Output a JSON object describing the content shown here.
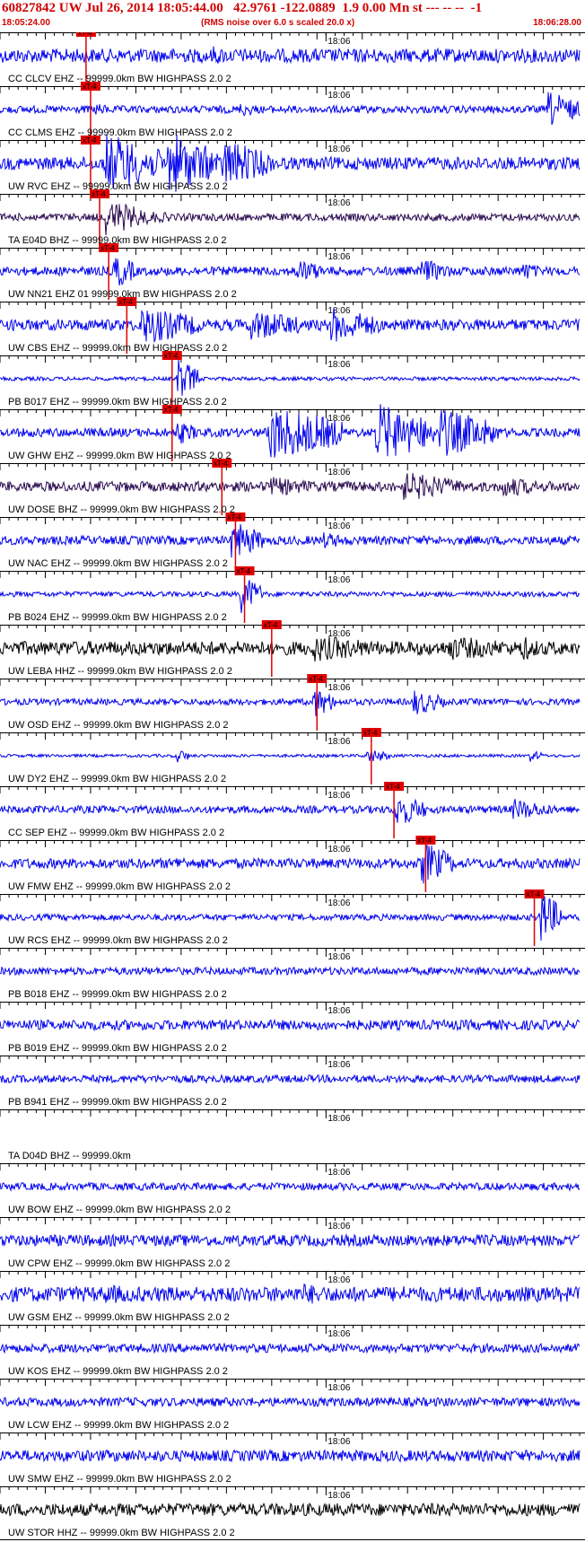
{
  "header": {
    "title": "60827842 UW Jul 26, 2014 18:05:44.00   42.9761 -122.0889  1.9 0.00 Mn st --- -- --  -1",
    "start_time": "18:05:24.00",
    "note": "(RMS noise over 6.0 s scaled 20.0 x)",
    "end_time": "18:06:28.00"
  },
  "chart_data": {
    "type": "line",
    "time_range": [
      "18:05:24.00",
      "18:06:28.00"
    ],
    "minute_mark": "18:06",
    "minute_mark_time_s": 36,
    "pick_label": "xT-4",
    "colors": {
      "blue": "#0000ee",
      "purple": "#2a0a50",
      "black": "#000000",
      "pick": "#e00000"
    },
    "traces": [
      {
        "label": "CC CLCV EHZ -- 99999.0km BW  HIGHPASS  2.0  2",
        "color": "blue",
        "pick_s": 9.5,
        "amp": 0.55,
        "bursts": [
          [
            10,
            3,
            0.6
          ],
          [
            24,
            2,
            0.8
          ],
          [
            31,
            2,
            0.4
          ]
        ]
      },
      {
        "label": "CC CLMS EHZ -- 99999.0km BW  HIGHPASS  2.0  2",
        "color": "blue",
        "pick_s": 10.0,
        "amp": 0.3,
        "bursts": [
          [
            11,
            2,
            0.5
          ],
          [
            27,
            2,
            0.6
          ],
          [
            61,
            3,
            1.5
          ]
        ]
      },
      {
        "label": "UW RVC EHZ -- 99999.0km BW  HIGHPASS  2.0  2",
        "color": "blue",
        "pick_s": 10.0,
        "amp": 0.5,
        "bursts": [
          [
            12,
            6,
            2.5
          ],
          [
            19,
            5,
            2.6
          ],
          [
            25,
            5,
            2.0
          ]
        ]
      },
      {
        "label": "TA E04D BHZ -- 99999.0km BW  HIGHPASS  2.0  2",
        "color": "purple",
        "pick_s": 11.0,
        "amp": 0.3,
        "bursts": [
          [
            12,
            4,
            1.5
          ],
          [
            16,
            4,
            0.6
          ]
        ]
      },
      {
        "label": "UW NN21 EHZ 01 99999.0km BW  HIGHPASS  2.0  2",
        "color": "blue",
        "pick_s": 12.0,
        "amp": 0.35,
        "bursts": [
          [
            13,
            2,
            1.5
          ],
          [
            33,
            3,
            1.0
          ],
          [
            47,
            3,
            1.0
          ],
          [
            58,
            2,
            0.8
          ]
        ]
      },
      {
        "label": "UW CBS EHZ -- 99999.0km BW  HIGHPASS  2.0  2",
        "color": "blue",
        "pick_s": 14.0,
        "amp": 0.45,
        "bursts": [
          [
            16,
            6,
            1.6
          ],
          [
            28,
            6,
            1.3
          ],
          [
            37,
            5,
            1.5
          ]
        ]
      },
      {
        "label": "PB B017 EHZ -- 99999.0km BW  HIGHPASS  2.0  2",
        "color": "blue",
        "pick_s": 19.0,
        "amp": 0.15,
        "bursts": [
          [
            20,
            2,
            1.7
          ]
        ]
      },
      {
        "label": "UW GHW EHZ -- 99999.0km BW  HIGHPASS  2.0  2",
        "color": "blue",
        "pick_s": 19.0,
        "amp": 0.35,
        "bursts": [
          [
            20,
            2,
            1.0
          ],
          [
            30,
            8,
            2.3
          ],
          [
            42,
            6,
            2.4
          ],
          [
            49,
            6,
            2.0
          ]
        ]
      },
      {
        "label": "UW DOSE BHZ -- 99999.0km BW  HIGHPASS  2.0  2",
        "color": "purple",
        "pick_s": 24.5,
        "amp": 0.4,
        "bursts": [
          [
            30,
            6,
            0.8
          ],
          [
            45,
            6,
            1.2
          ],
          [
            56,
            4,
            0.9
          ]
        ]
      },
      {
        "label": "UW NAC EHZ -- 99999.0km BW  HIGHPASS  2.0  2",
        "color": "blue",
        "pick_s": 26.0,
        "amp": 0.35,
        "bursts": [
          [
            26,
            3,
            1.6
          ],
          [
            36,
            3,
            0.7
          ]
        ]
      },
      {
        "label": "PB B024 EHZ -- 99999.0km BW  HIGHPASS  2.0  2",
        "color": "blue",
        "pick_s": 27.0,
        "amp": 0.2,
        "bursts": [
          [
            27,
            2,
            1.6
          ]
        ]
      },
      {
        "label": "UW LEBA HHZ -- 99999.0km BW  HIGHPASS  2.0  2",
        "color": "black",
        "pick_s": 30.0,
        "amp": 0.55,
        "bursts": [
          [
            35,
            8,
            1.1
          ],
          [
            50,
            8,
            1.0
          ],
          [
            58,
            2,
            1.1
          ]
        ]
      },
      {
        "label": "UW OSD EHZ -- 99999.0km BW  HIGHPASS  2.0  2",
        "color": "blue",
        "pick_s": 35.0,
        "amp": 0.25,
        "bursts": [
          [
            35,
            2,
            1.3
          ],
          [
            46,
            3,
            1.1
          ]
        ]
      },
      {
        "label": "UW DY2 EHZ -- 99999.0km BW  HIGHPASS  2.0  2",
        "color": "blue",
        "pick_s": 41.0,
        "amp": 0.12,
        "bursts": [
          [
            20,
            1,
            0.6
          ],
          [
            41,
            2,
            0.6
          ],
          [
            59,
            1,
            0.5
          ]
        ]
      },
      {
        "label": "CC SEP EHZ -- 99999.0km BW  HIGHPASS  2.0  2",
        "color": "blue",
        "pick_s": 43.5,
        "amp": 0.3,
        "bursts": [
          [
            44,
            3,
            1.4
          ],
          [
            57,
            4,
            0.9
          ]
        ]
      },
      {
        "label": "UW FMW EHZ -- 99999.0km BW  HIGHPASS  2.0  2",
        "color": "blue",
        "pick_s": 47.0,
        "amp": 0.4,
        "bursts": [
          [
            20,
            2,
            0.6
          ],
          [
            47,
            3,
            1.8
          ]
        ]
      },
      {
        "label": "UW RCS EHZ -- 99999.0km BW  HIGHPASS  2.0  2",
        "color": "blue",
        "pick_s": 59.0,
        "amp": 0.25,
        "bursts": [
          [
            60,
            2,
            2.2
          ]
        ]
      },
      {
        "label": "PB B018 EHZ -- 99999.0km BW  HIGHPASS  2.0  2",
        "color": "blue",
        "amp": 0.3,
        "bursts": []
      },
      {
        "label": "PB B019 EHZ -- 99999.0km BW  HIGHPASS  2.0  2",
        "color": "blue",
        "amp": 0.4,
        "bursts": []
      },
      {
        "label": "PB B941 EHZ -- 99999.0km BW  HIGHPASS  2.0  2",
        "color": "blue",
        "amp": 0.3,
        "bursts": []
      },
      {
        "label": "TA D04D BHZ -- 99999.0km",
        "color": "none",
        "amp": 0,
        "bursts": []
      },
      {
        "label": "UW BOW EHZ -- 99999.0km BW  HIGHPASS  2.0  2",
        "color": "blue",
        "amp": 0.3,
        "bursts": []
      },
      {
        "label": "UW CPW EHZ -- 99999.0km BW  HIGHPASS  2.0  2",
        "color": "blue",
        "amp": 0.45,
        "bursts": []
      },
      {
        "label": "UW GSM EHZ -- 99999.0km BW  HIGHPASS  2.0  2",
        "color": "blue",
        "amp": 0.6,
        "bursts": [
          [
            12,
            6,
            0.8
          ],
          [
            34,
            4,
            0.9
          ],
          [
            45,
            5,
            0.7
          ]
        ]
      },
      {
        "label": "UW KOS EHZ -- 99999.0km BW  HIGHPASS  2.0  2",
        "color": "blue",
        "amp": 0.35,
        "bursts": []
      },
      {
        "label": "UW LCW EHZ -- 99999.0km BW  HIGHPASS  2.0  2",
        "color": "blue",
        "amp": 0.35,
        "bursts": []
      },
      {
        "label": "UW SMW EHZ -- 99999.0km BW  HIGHPASS  2.0  2",
        "color": "blue",
        "amp": 0.45,
        "bursts": []
      },
      {
        "label": "UW STOR HHZ -- 99999.0km BW  HIGHPASS  2.0  2",
        "color": "black",
        "amp": 0.5,
        "bursts": []
      }
    ]
  }
}
